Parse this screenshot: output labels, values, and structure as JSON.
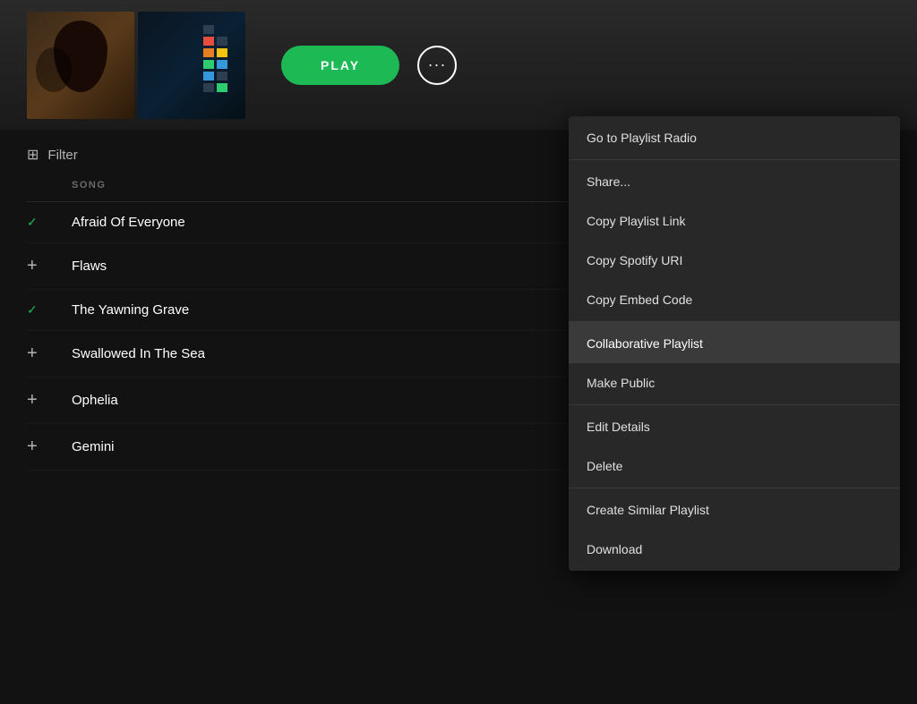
{
  "header": {
    "play_label": "PLAY",
    "more_label": "···"
  },
  "filter": {
    "label": "Filter"
  },
  "song_list": {
    "column_header": "SONG",
    "songs": [
      {
        "title": "Afraid Of Everyone",
        "indicator": "check"
      },
      {
        "title": "Flaws",
        "indicator": "plus"
      },
      {
        "title": "The Yawning Grave",
        "indicator": "check"
      },
      {
        "title": "Swallowed In The Sea",
        "indicator": "plus"
      },
      {
        "title": "Ophelia",
        "indicator": "plus"
      },
      {
        "title": "Gemini",
        "indicator": "plus"
      }
    ]
  },
  "context_menu": {
    "sections": [
      {
        "id": "radio",
        "items": [
          {
            "id": "playlist-radio",
            "label": "Go to Playlist Radio"
          }
        ]
      },
      {
        "id": "share",
        "items": [
          {
            "id": "share",
            "label": "Share..."
          },
          {
            "id": "copy-playlist-link",
            "label": "Copy Playlist Link"
          },
          {
            "id": "copy-spotify-uri",
            "label": "Copy Spotify URI"
          },
          {
            "id": "copy-embed-code",
            "label": "Copy Embed Code"
          }
        ]
      },
      {
        "id": "collaborate",
        "items": [
          {
            "id": "collaborative-playlist",
            "label": "Collaborative Playlist",
            "highlighted": true
          },
          {
            "id": "make-public",
            "label": "Make Public"
          }
        ]
      },
      {
        "id": "manage",
        "items": [
          {
            "id": "edit-details",
            "label": "Edit Details"
          },
          {
            "id": "delete",
            "label": "Delete"
          }
        ]
      },
      {
        "id": "similar",
        "items": [
          {
            "id": "create-similar",
            "label": "Create Similar Playlist"
          },
          {
            "id": "download",
            "label": "Download"
          }
        ]
      }
    ]
  }
}
